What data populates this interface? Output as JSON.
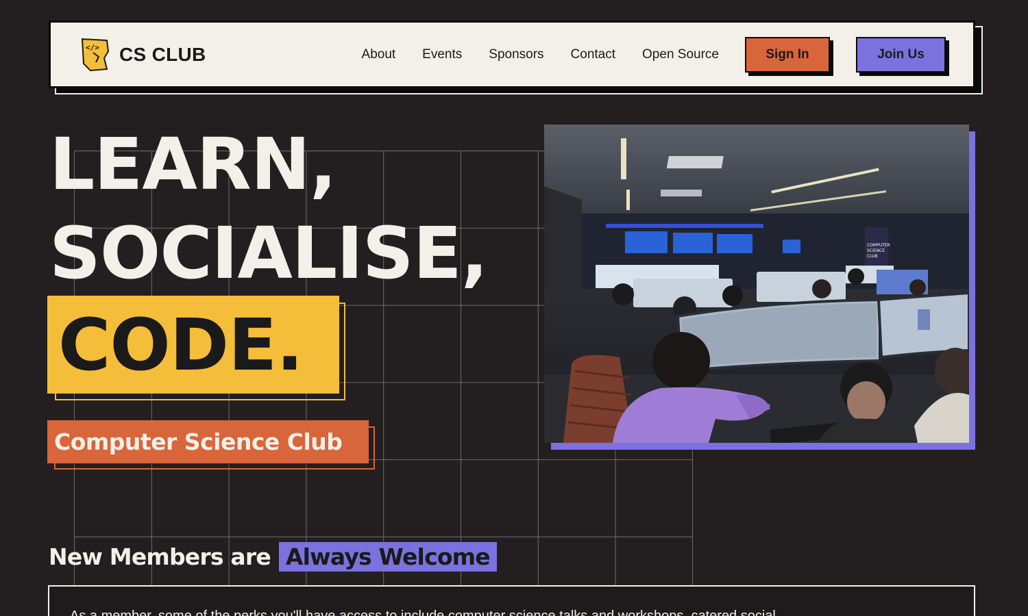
{
  "nav": {
    "logo_text": "CS CLUB",
    "links": [
      "About",
      "Events",
      "Sponsors",
      "Contact",
      "Open Source"
    ],
    "signin_label": "Sign In",
    "join_label": "Join Us"
  },
  "hero": {
    "line1": "LEARN,",
    "line2": "SOCIALISE,",
    "line3": "CODE.",
    "subtitle": "Computer Science Club",
    "photo_banner_text": "COMPUTER SCIENCE CLUB"
  },
  "welcome": {
    "prefix": "New Members are",
    "highlight": "Always Welcome"
  },
  "info": {
    "text": "As a member, some of the perks you'll have access to include computer science talks and workshops, catered social"
  },
  "colors": {
    "background": "#231f20",
    "cream": "#f2f0e8",
    "yellow": "#f4bd3a",
    "orange": "#d9653a",
    "purple": "#7b72e0"
  },
  "icons": {
    "logo": "code-map-logo-icon"
  }
}
